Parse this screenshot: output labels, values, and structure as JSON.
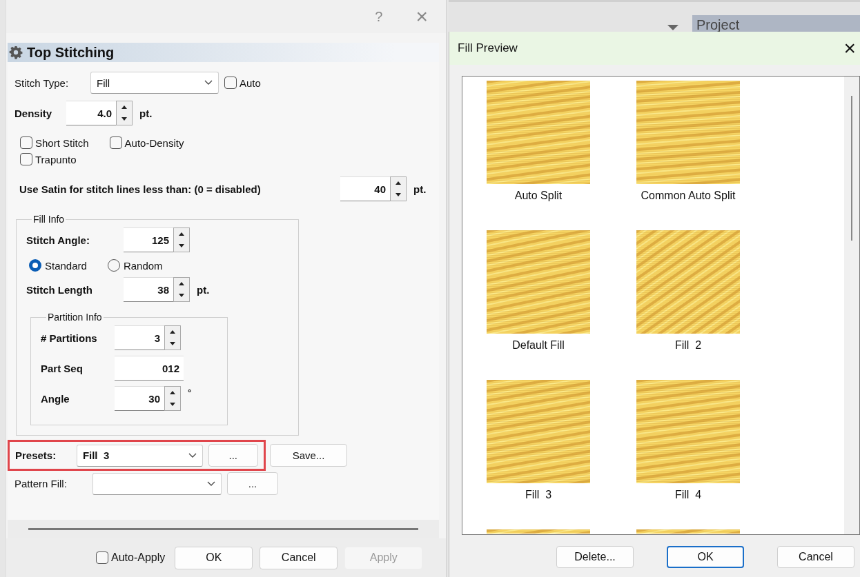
{
  "settings_dialog": {
    "help_glyph": "?",
    "close_glyph": "×",
    "panel_title": "Top Stitching",
    "stitch_type": {
      "label": "Stitch Type:",
      "value": "Fill"
    },
    "auto": {
      "label": "Auto",
      "checked": false
    },
    "density": {
      "label": "Density",
      "value": "4.0",
      "unit": "pt."
    },
    "options": [
      {
        "label": "Short Stitch",
        "checked": false
      },
      {
        "label": "Auto-Density",
        "checked": false
      },
      {
        "label": "Trapunto",
        "checked": false
      }
    ],
    "satin": {
      "label": "Use Satin for stitch lines less than: (0 = disabled)",
      "value": "40",
      "unit": "pt."
    },
    "fill_info": {
      "legend": "Fill Info",
      "stitch_angle": {
        "label": "Stitch Angle:",
        "value": "125"
      },
      "modes": [
        {
          "label": "Standard",
          "selected": true
        },
        {
          "label": "Random",
          "selected": false
        }
      ],
      "stitch_length": {
        "label": "Stitch Length",
        "value": "38",
        "unit": "pt."
      },
      "partition_info": {
        "legend": "Partition Info",
        "fields": [
          {
            "kind": "spin",
            "label": "# Partitions",
            "value": "3"
          },
          {
            "kind": "text",
            "label": "Part Seq",
            "value": "012"
          },
          {
            "kind": "spin",
            "label": "Angle",
            "value": "30",
            "unit": "°"
          }
        ]
      }
    },
    "presets": {
      "label": "Presets:",
      "value": "Fill  3",
      "browse": "...",
      "highlighted": true
    },
    "save_button": "Save...",
    "pattern_fill": {
      "label": "Pattern Fill:",
      "browse": "..."
    },
    "auto_apply": {
      "label": "Auto-Apply",
      "checked": false
    },
    "buttons": [
      {
        "label": "OK",
        "disabled": false
      },
      {
        "label": "Cancel",
        "disabled": false
      },
      {
        "label": "Apply",
        "disabled": true
      }
    ]
  },
  "background": {
    "tab": "Project"
  },
  "fill_preview": {
    "title": "Fill Preview",
    "close_glyph": "×",
    "items": [
      {
        "kind": "preset",
        "label": "Auto Split"
      },
      {
        "kind": "preset",
        "label": "Common Auto Split"
      },
      {
        "kind": "preset",
        "label": "Default Fill"
      },
      {
        "kind": "preset",
        "label": "Fill  2"
      },
      {
        "kind": "preset",
        "label": "Fill  3"
      },
      {
        "kind": "preset",
        "label": "Fill  4"
      },
      {
        "kind": "partial"
      },
      {
        "kind": "partial"
      }
    ],
    "buttons": [
      {
        "label": "Delete...",
        "default": false
      },
      {
        "label": "OK",
        "default": true
      },
      {
        "label": "Cancel",
        "default": false
      }
    ]
  }
}
